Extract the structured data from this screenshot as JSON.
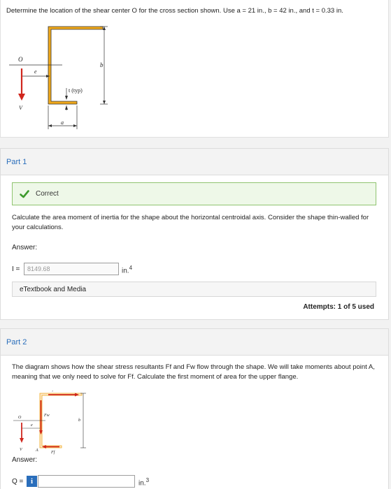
{
  "problem": {
    "text": "Determine the location of the shear center O for the cross section shown. Use a = 21 in., b = 42 in., and t = 0.33 in.",
    "figure": {
      "label_O": "O",
      "label_e": "e",
      "label_b": "b",
      "label_t": "t (typ)",
      "label_a": "a",
      "label_V": "V",
      "section_color": "#f0a91b",
      "force_color": "#d0261d"
    }
  },
  "part1": {
    "title": "Part 1",
    "status": "Correct",
    "question": "Calculate the area moment of inertia for the shape about the horizontal centroidal axis. Consider the shape thin-walled for your calculations.",
    "answer_label": "Answer:",
    "field_prefix": "I =",
    "field_value": "8149.68",
    "unit": "in.",
    "unit_exp": "4",
    "etextbook": "eTextbook and Media",
    "attempts": "Attempts: 1 of 5 used"
  },
  "part2": {
    "title": "Part 2",
    "question": "The diagram shows how the shear stress resultants Ff and Fw flow through the shape. We will take moments about point A, meaning that we only need to solve for Ff. Calculate the first moment of area for the upper flange.",
    "figure": {
      "label_Ff_top": "Ff",
      "label_Fw": "Fw",
      "label_Ff_bottom": "Ff",
      "label_O": "O",
      "label_e": "e",
      "label_b": "b",
      "label_V": "V",
      "label_A": "A"
    },
    "answer_label": "Answer:",
    "field_prefix": "Q =",
    "info_glyph": "i",
    "field_value": "",
    "unit": "in.",
    "unit_exp": "3"
  }
}
